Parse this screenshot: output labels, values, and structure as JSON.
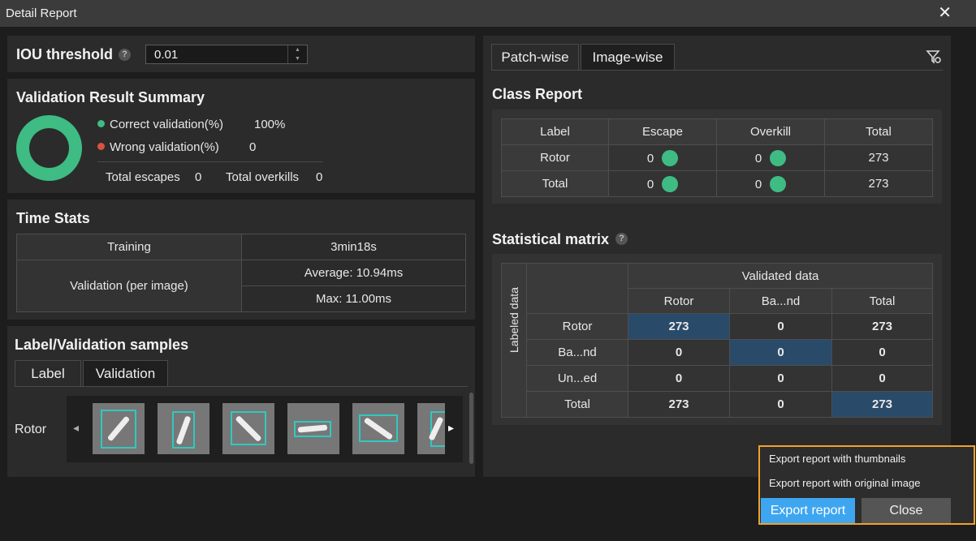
{
  "window": {
    "title": "Detail Report",
    "close_glyph": "✕"
  },
  "iou": {
    "label": "IOU threshold",
    "help": "?",
    "value": "0.01",
    "up": "▲",
    "down": "▼"
  },
  "summary": {
    "title": "Validation Result Summary",
    "correct_label": "Correct validation(%)",
    "correct_value": "100%",
    "wrong_label": "Wrong validation(%)",
    "wrong_value": "0",
    "escapes_label": "Total escapes",
    "escapes_value": "0",
    "overkills_label": "Total overkills",
    "overkills_value": "0",
    "correct_color": "#3ebc83",
    "wrong_color": "#d9523f"
  },
  "time_stats": {
    "title": "Time Stats",
    "training_label": "Training",
    "training_value": "3min18s",
    "validation_label": "Validation (per image)",
    "average": "Average: 10.94ms",
    "max": "Max: 11.00ms"
  },
  "samples": {
    "title": "Label/Validation samples",
    "tabs": [
      "Label",
      "Validation"
    ],
    "row_label": "Rotor",
    "left_arrow": "◂",
    "right_arrow": "▸"
  },
  "right_tabs": [
    "Patch-wise",
    "Image-wise"
  ],
  "filter_icon": "filter-icon",
  "class_report": {
    "title": "Class Report",
    "headers": [
      "Label",
      "Escape",
      "Overkill",
      "Total"
    ],
    "rows": [
      {
        "label": "Rotor",
        "escape": "0",
        "overkill": "0",
        "total": "273"
      },
      {
        "label": "Total",
        "escape": "0",
        "overkill": "0",
        "total": "273"
      }
    ]
  },
  "matrix": {
    "title": "Statistical matrix",
    "help": "?",
    "top_header": "Validated data",
    "side_header": "Labeled data",
    "col_headers": [
      "Rotor",
      "Ba...nd",
      "Total"
    ],
    "rows": [
      {
        "label": "Rotor",
        "cells": [
          "273",
          "0",
          "273"
        ]
      },
      {
        "label": "Ba...nd",
        "cells": [
          "0",
          "0",
          "0"
        ]
      },
      {
        "label": "Un...ed",
        "cells": [
          "0",
          "0",
          "0"
        ]
      },
      {
        "label": "Total",
        "cells": [
          "273",
          "0",
          "273"
        ]
      }
    ]
  },
  "export_menu": {
    "items": [
      "Export report with thumbnails",
      "Export report with original image"
    ],
    "export_button": "Export report",
    "close_button": "Close"
  },
  "colors": {
    "accent": "#3ea6f0",
    "highlight": "#f0a12a",
    "matrix_diag": "#2a4a6a"
  }
}
